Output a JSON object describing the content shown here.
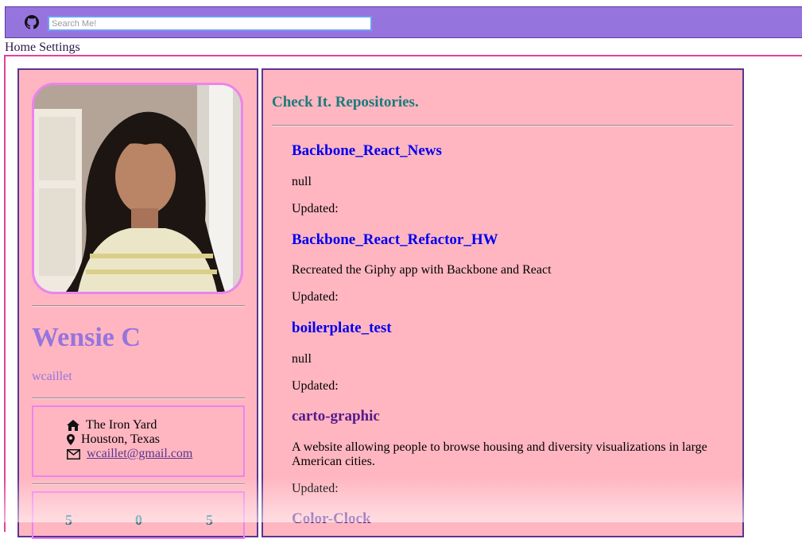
{
  "header": {
    "search_placeholder": "Search Me!"
  },
  "nav": {
    "home": "Home",
    "settings": "Settings"
  },
  "profile": {
    "name": "Wensie C",
    "login": "wcaillet",
    "company": "The Iron Yard",
    "location": "Houston, Texas",
    "email": "wcaillet@gmail.com",
    "stats": [
      "5",
      "0",
      "5"
    ]
  },
  "repos": {
    "heading": "Check It. Repositories.",
    "items": [
      {
        "name": "Backbone_React_News",
        "description": "null",
        "updated": "Updated:"
      },
      {
        "name": "Backbone_React_Refactor_HW",
        "description": "Recreated the Giphy app with Backbone and React",
        "updated": "Updated:"
      },
      {
        "name": "boilerplate_test",
        "description": "null",
        "updated": "Updated:"
      },
      {
        "name": "carto-graphic",
        "description": "A website allowing people to browse housing and diversity visualizations in large American cities.",
        "updated": "Updated:"
      },
      {
        "name": "Color-Clock",
        "description": "",
        "updated": ""
      }
    ]
  },
  "colors": {
    "header_bg": "#9674de",
    "panel_bg": "#ffb6c1",
    "accent": "#ee82ee",
    "link_blue": "#0000ee",
    "link_visited": "#551a8b",
    "heading_teal": "#1a7b7b"
  }
}
